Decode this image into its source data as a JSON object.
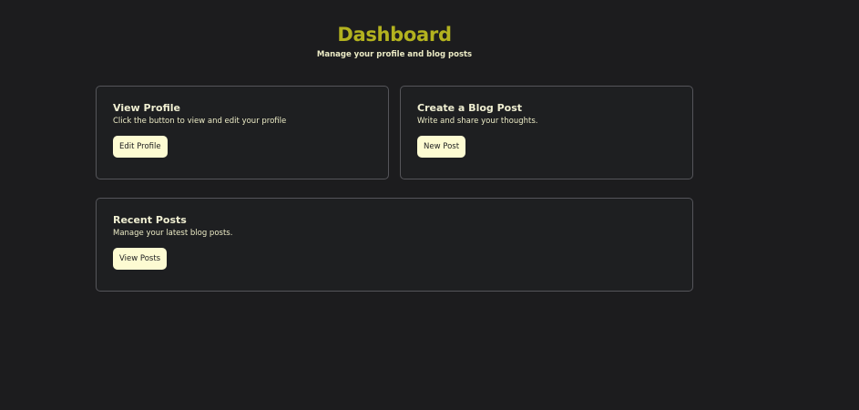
{
  "header": {
    "title": "Dashboard",
    "subtitle": "Manage your profile and blog posts"
  },
  "cards": {
    "profile": {
      "title": "View Profile",
      "description": "Click the button to view and edit your profile",
      "button_label": "Edit Profile"
    },
    "blog": {
      "title": "Create a Blog Post",
      "description": "Write and share your thoughts.",
      "button_label": "New Post"
    },
    "recent": {
      "title": "Recent Posts",
      "description": "Manage your latest blog posts.",
      "button_label": "View Posts"
    }
  },
  "colors": {
    "background": "#1c1c1e",
    "title_accent": "#b3b21f",
    "button_bg": "#fdfbd2",
    "card_border": "#55555a"
  }
}
